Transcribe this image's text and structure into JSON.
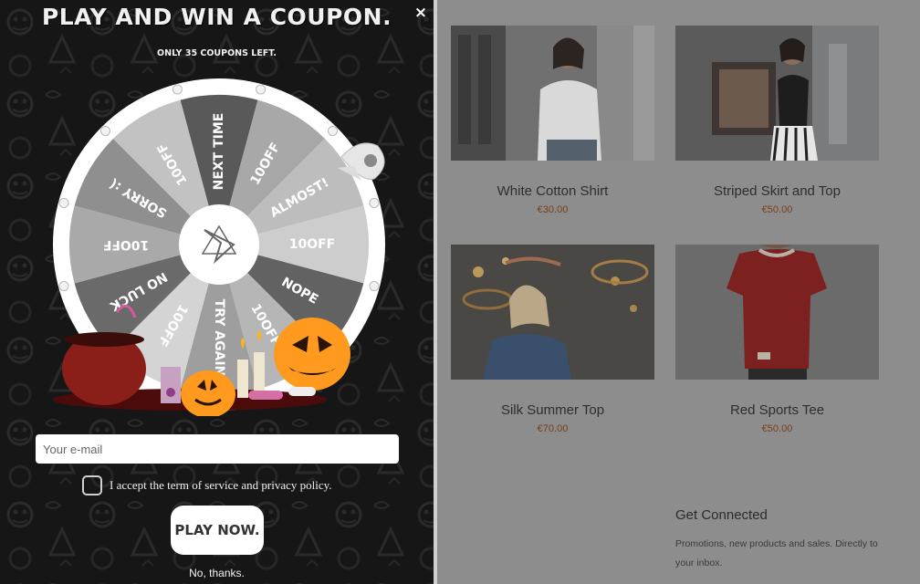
{
  "popup": {
    "title": "PLAY AND WIN A COUPON.",
    "subtitle": "ONLY 35 COUPONS LEFT.",
    "close_label": "×",
    "wheel_segments": [
      "NEXT TIME",
      "10OFF",
      "ALMOST!",
      "10OFF",
      "NOPE",
      "10OFF",
      "TRY AGAIN",
      "10OFF",
      "NO LUCK",
      "10OFF",
      "SORRY :(",
      "10OFF"
    ],
    "email_placeholder": "Your e-mail",
    "consent_label": "I accept the term of service and privacy policy.",
    "play_label": "PLAY NOW.",
    "no_thanks_label": "No, thanks."
  },
  "products": [
    {
      "name": "White Cotton Shirt",
      "price": "€30.00"
    },
    {
      "name": "Striped Skirt and Top",
      "price": "€50.00"
    },
    {
      "name": "Silk Summer Top",
      "price": "€70.00"
    },
    {
      "name": "Red Sports Tee",
      "price": "€50.00"
    }
  ],
  "connect": {
    "heading": "Get Connected",
    "text": "Promotions, new products and sales. Directly to your inbox."
  },
  "colors": {
    "popup_bg": "#161616",
    "overlay": "#8d8d8d",
    "price": "#7a3f14"
  }
}
